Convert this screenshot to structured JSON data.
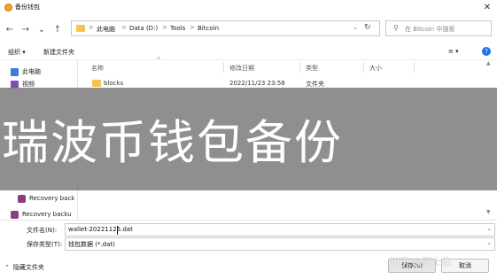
{
  "window": {
    "title": "备份钱包",
    "close_glyph": "✕"
  },
  "nav": {
    "back": "←",
    "forward": "→",
    "recent": "⌄",
    "up": "↑"
  },
  "address": {
    "crumbs": [
      "此电脑",
      "Data (D:)",
      "Tools",
      "Bitcoin"
    ],
    "separator": ">",
    "dropdown": "⌄",
    "refresh": "↻"
  },
  "search": {
    "placeholder": "在 Bitcoin 中搜索",
    "icon": "search-icon"
  },
  "toolbar": {
    "organize": "组织 ▾",
    "new_folder": "新建文件夹",
    "view": "≡ ▾",
    "help": "?"
  },
  "sidebar": {
    "items": [
      {
        "label": "此电脑",
        "icon": "computer-icon"
      },
      {
        "label": "视频",
        "icon": "video-icon"
      },
      {
        "label": "Recovery back",
        "icon": "drive-icon"
      },
      {
        "label": "Recovery backu",
        "icon": "drive-icon"
      }
    ]
  },
  "columns": {
    "name": "名称",
    "modified": "修改日期",
    "type": "类型",
    "size": "大小"
  },
  "files": [
    {
      "name": "blocks",
      "modified": "2022/11/23 23:58",
      "type": "文件夹",
      "size": ""
    }
  ],
  "banner": {
    "text": "瑞波币钱包备份"
  },
  "save_dialog": {
    "filename_label": "文件名(N):",
    "filename_value": "wallet-20221126.dat",
    "filetype_label": "保存类型(T):",
    "filetype_value": "钱包数据 (*.dat)",
    "hide_folders": "隐藏文件夹",
    "hide_toggle": "⌃",
    "save_button": "保存(S)",
    "cancel_button": "取消"
  },
  "watermark": {
    "text": "知乎 @阿士伯"
  },
  "colors": {
    "banner": "#808080",
    "folder": "#f4c44e",
    "accent": "#1a73e8"
  }
}
